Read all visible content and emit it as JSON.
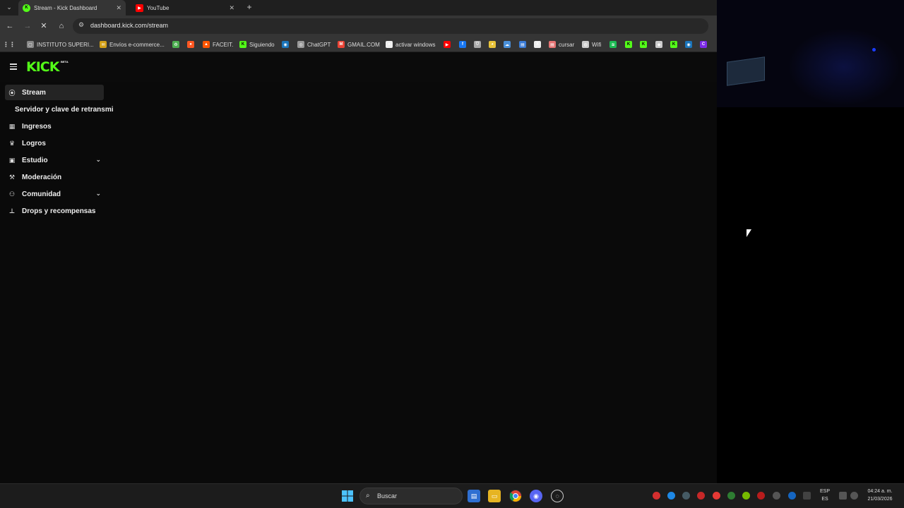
{
  "browser": {
    "tabs": [
      {
        "title": "Stream - Kick Dashboard",
        "favicon": "kick",
        "color": "#53fc18",
        "active": true
      },
      {
        "title": "YouTube",
        "favicon": "youtube",
        "color": "#ff0000",
        "active": false
      }
    ],
    "url": "dashboard.kick.com/stream",
    "bookmarks": [
      {
        "label": "INSTITUTO SUPERI...",
        "icon": "page",
        "color": "#888"
      },
      {
        "label": "Envíos e-commerce...",
        "icon": "mail",
        "color": "#d4a017"
      },
      {
        "label": "",
        "icon": "recycle",
        "color": "#4caf50"
      },
      {
        "label": "",
        "icon": "circle",
        "color": "#ff5722"
      },
      {
        "label": "FACEIT.",
        "icon": "faceit",
        "color": "#ff5500"
      },
      {
        "label": "Siguiendo",
        "icon": "kick",
        "color": "#53fc18"
      },
      {
        "label": "",
        "icon": "steam",
        "color": "#1b75bb"
      },
      {
        "label": "ChatGPT",
        "icon": "openai",
        "color": "#999"
      },
      {
        "label": "GMAIL.COM",
        "icon": "gmail",
        "color": "#ea4335"
      },
      {
        "label": "activar windows",
        "icon": "github",
        "color": "#eee"
      },
      {
        "label": "",
        "icon": "youtube",
        "color": "#ff0000"
      },
      {
        "label": "",
        "icon": "facebook",
        "color": "#1877f2"
      },
      {
        "label": "",
        "icon": "shield",
        "color": "#aaa"
      },
      {
        "label": "",
        "icon": "eye",
        "color": "#e8c33a"
      },
      {
        "label": "",
        "icon": "cloud",
        "color": "#4a90d9"
      },
      {
        "label": "",
        "icon": "window",
        "color": "#3a7bd5"
      },
      {
        "label": "",
        "icon": "x",
        "color": "#eee"
      },
      {
        "label": "cursar",
        "icon": "doc",
        "color": "#e57373"
      },
      {
        "label": "Wifi",
        "icon": "globe",
        "color": "#ccc"
      },
      {
        "label": "",
        "icon": "spotify",
        "color": "#1db954"
      },
      {
        "label": "",
        "icon": "kick",
        "color": "#53fc18"
      },
      {
        "label": "",
        "icon": "kick",
        "color": "#53fc18"
      },
      {
        "label": "",
        "icon": "discord",
        "color": "#ccc"
      },
      {
        "label": "",
        "icon": "kick",
        "color": "#53fc18"
      },
      {
        "label": "",
        "icon": "steam",
        "color": "#1b75bb"
      },
      {
        "label": "",
        "icon": "canva",
        "color": "#7d2ae8"
      }
    ]
  },
  "kick": {
    "logo": "KICK",
    "beta": "BETA"
  },
  "sidebar": {
    "items": [
      {
        "label": "Stream",
        "icon": "broadcast-icon",
        "glyph": "⦿",
        "active": true
      },
      {
        "label": "Servidor y clave de retransmisión",
        "sub": true
      },
      {
        "label": "Ingresos",
        "icon": "chart-icon",
        "glyph": "▦"
      },
      {
        "label": "Logros",
        "icon": "trophy-icon",
        "glyph": "🏆"
      },
      {
        "label": "Estudio",
        "icon": "studio-icon",
        "glyph": "▣",
        "expandable": true
      },
      {
        "label": "Moderación",
        "icon": "wrench-icon",
        "glyph": "🔧"
      },
      {
        "label": "Comunidad",
        "icon": "community-icon",
        "glyph": "⚇",
        "expandable": true
      },
      {
        "label": "Drops y recompensas",
        "icon": "drops-icon",
        "glyph": "⩩"
      }
    ]
  },
  "taskbar": {
    "search_placeholder": "Buscar",
    "lang_line1": "ESP",
    "lang_line2": "ES",
    "time": "04:24 a. m.",
    "date": "21/03/2026"
  }
}
